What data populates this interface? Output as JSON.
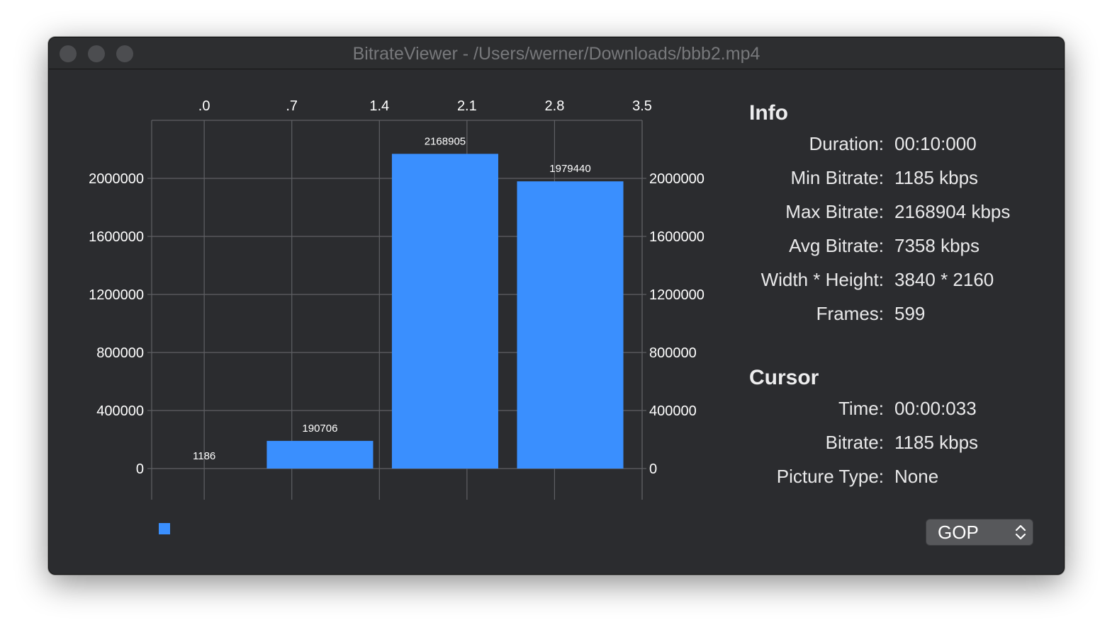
{
  "window": {
    "title": "BitrateViewer - /Users/werner/Downloads/bbb2.mp4"
  },
  "chart_data": {
    "type": "bar",
    "x_ticks": [
      ".0",
      ".7",
      "1.4",
      "2.1",
      "2.8",
      "3.5"
    ],
    "y_ticks": [
      "0",
      "400000",
      "800000",
      "1200000",
      "1600000",
      "2000000"
    ],
    "xlim": [
      -0.42,
      3.5
    ],
    "ylim": [
      0,
      2400000
    ],
    "bars": [
      {
        "x0": 0.0,
        "x1": 0.0,
        "value": 1186,
        "label": "1186"
      },
      {
        "x0": 0.5,
        "x1": 1.35,
        "value": 190706,
        "label": "190706"
      },
      {
        "x0": 1.5,
        "x1": 2.35,
        "value": 2168905,
        "label": "2168905"
      },
      {
        "x0": 2.5,
        "x1": 3.35,
        "value": 1979440,
        "label": "1979440"
      }
    ],
    "bar_color": "#3a8ffe",
    "grid": true,
    "legend": "bottom-left"
  },
  "info": {
    "title": "Info",
    "rows": [
      {
        "label": "Duration:",
        "value": "00:10:000"
      },
      {
        "label": "Min Bitrate:",
        "value": "1185 kbps"
      },
      {
        "label": "Max Bitrate:",
        "value": "2168904 kbps"
      },
      {
        "label": "Avg Bitrate:",
        "value": "7358 kbps"
      },
      {
        "label": "Width * Height:",
        "value": "3840 * 2160"
      },
      {
        "label": "Frames:",
        "value": "599"
      }
    ]
  },
  "cursor": {
    "title": "Cursor",
    "rows": [
      {
        "label": "Time:",
        "value": "00:00:033"
      },
      {
        "label": "Bitrate:",
        "value": "1185 kbps"
      },
      {
        "label": "Picture Type:",
        "value": "None"
      }
    ]
  },
  "mode_select": {
    "value": "GOP"
  }
}
